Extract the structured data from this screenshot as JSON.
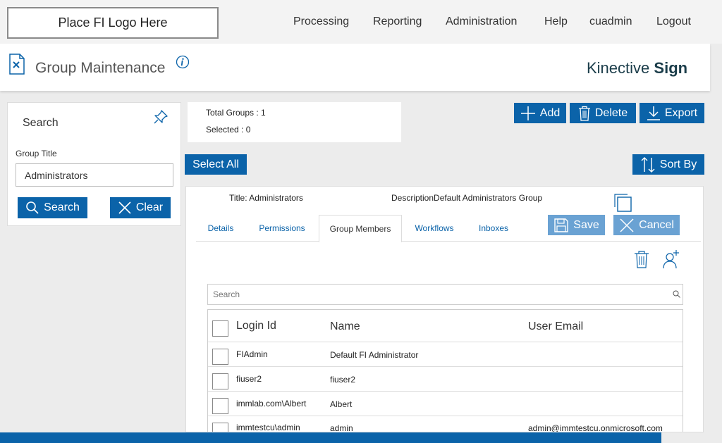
{
  "header": {
    "logo_placeholder": "Place FI Logo Here",
    "nav": [
      "Processing",
      "Reporting",
      "Administration",
      "Help",
      "cuadmin",
      "Logout"
    ]
  },
  "title_bar": {
    "page_title": "Group Maintenance",
    "brand_regular": "Kinective",
    "brand_bold": "Sign"
  },
  "search_panel": {
    "title": "Search",
    "field_label": "Group Title",
    "field_value": "Administrators",
    "search_label": "Search",
    "clear_label": "Clear"
  },
  "summary": {
    "total": "Total Groups : 1",
    "selected": "Selected : 0"
  },
  "actions": {
    "add": "Add",
    "delete": "Delete",
    "export": "Export",
    "select_all": "Select All",
    "sort_by": "Sort By"
  },
  "group_card": {
    "title_line": "Title: Administrators",
    "description_label": "Description",
    "description_value": "Default Administrators Group",
    "tabs": [
      "Details",
      "Permissions",
      "Group Members",
      "Workflows",
      "Inboxes"
    ],
    "active_tab": "Group Members",
    "save_label": "Save",
    "cancel_label": "Cancel"
  },
  "members": {
    "search_placeholder": "Search",
    "columns": [
      "Login Id",
      "Name",
      "User Email"
    ],
    "rows": [
      {
        "login": "FIAdmin",
        "name": "Default FI Administrator",
        "email": ""
      },
      {
        "login": "fiuser2",
        "name": "fiuser2",
        "email": ""
      },
      {
        "login": "immlab.com\\Albert",
        "name": "Albert",
        "email": ""
      },
      {
        "login": "immtestcu\\admin",
        "name": "admin",
        "email": "admin@immtestcu.onmicrosoft.com"
      }
    ]
  },
  "colors": {
    "primary": "#0b63a9",
    "primary_light": "#6aa2d3",
    "brand_text": "#1b3d4a",
    "background": "#ececec"
  },
  "icons": [
    "document-icon",
    "info-icon",
    "pin-icon",
    "search-icon",
    "close-icon",
    "plus-icon",
    "trash-icon",
    "download-icon",
    "sort-icon",
    "save-icon",
    "copy-icon",
    "add-user-icon"
  ]
}
